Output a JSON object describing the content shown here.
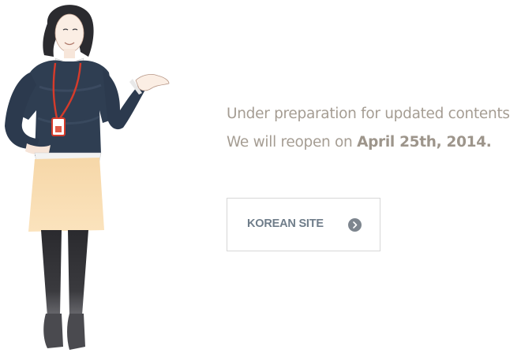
{
  "notice": {
    "line1": "Under preparation for updated contents",
    "line2_prefix": "We will reopen on ",
    "line2_date": "April 25th, 2014."
  },
  "site_button": {
    "label": "KOREAN SITE",
    "icon": "chevron-right-circle-icon"
  },
  "colors": {
    "text": "#a59d93",
    "button_text": "#6f7d8a",
    "button_border": "#d7d7d7",
    "icon_circle": "#7d858e"
  }
}
